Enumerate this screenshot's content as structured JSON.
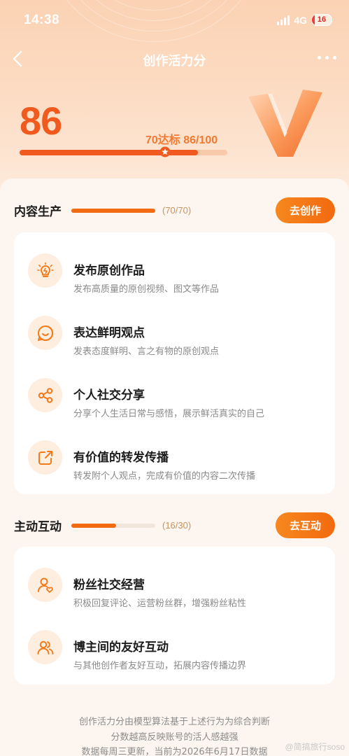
{
  "status_bar": {
    "time": "14:38",
    "network": "4G",
    "battery": "16"
  },
  "nav": {
    "title": "创作活力分"
  },
  "score": {
    "value": "86",
    "target_text": "70达标 86/100",
    "progress": 0.86,
    "target_mark": 0.7
  },
  "colors": {
    "accent": "#f26b12",
    "score": "#f05a1e"
  },
  "sections": [
    {
      "title": "内容生产",
      "count": "(70/70)",
      "progress": 1.0,
      "button": "去创作",
      "items": [
        {
          "icon": "lightbulb-icon",
          "title": "发布原创作品",
          "desc": "发布高质量的原创视频、图文等作品"
        },
        {
          "icon": "smile-bubble-icon",
          "title": "表达鲜明观点",
          "desc": "发表态度鲜明、言之有物的原创观点"
        },
        {
          "icon": "share-icon",
          "title": "个人社交分享",
          "desc": "分享个人生活日常与感悟，展示鲜活真实的自己"
        },
        {
          "icon": "forward-icon",
          "title": "有价值的转发传播",
          "desc": "转发附个人观点，完成有价值的内容二次传播"
        }
      ]
    },
    {
      "title": "主动互动",
      "count": "(16/30)",
      "progress": 0.533,
      "button": "去互动",
      "items": [
        {
          "icon": "user-heart-icon",
          "title": "粉丝社交经营",
          "desc": "积极回复评论、运营粉丝群，增强粉丝粘性"
        },
        {
          "icon": "users-icon",
          "title": "博主间的友好互动",
          "desc": "与其他创作者友好互动，拓展内容传播边界"
        }
      ]
    }
  ],
  "footer": {
    "line1": "创作活力分由模型算法基于上述行为为综合判断",
    "line2": "分数越高反映账号的活人感越强",
    "line3": "数据每周三更新，当前为2026年6月17日数据"
  },
  "watermark": "@简搞旅行soso"
}
